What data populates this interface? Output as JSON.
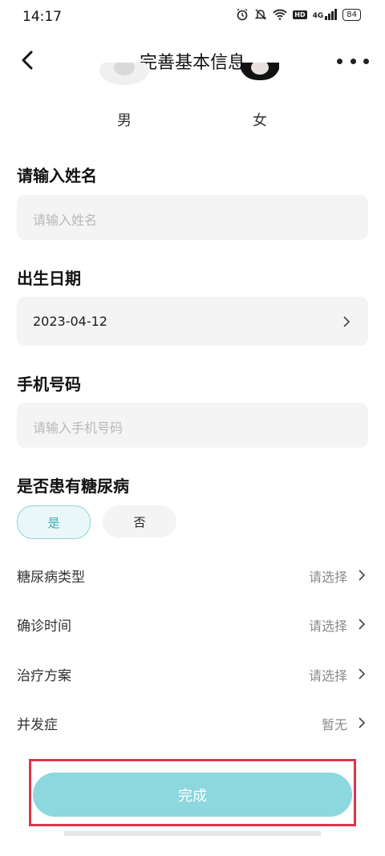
{
  "status": {
    "time": "14:17",
    "battery": "84",
    "network": "4G",
    "hd": "HD"
  },
  "header": {
    "title": "完善基本信息"
  },
  "gender": {
    "male": "男",
    "female": "女"
  },
  "name": {
    "label": "请输入姓名",
    "placeholder": "请输入姓名"
  },
  "birth": {
    "label": "出生日期",
    "value": "2023-04-12"
  },
  "phone": {
    "label": "手机号码",
    "placeholder": "请输入手机号码"
  },
  "diabetes": {
    "label": "是否患有糖尿病",
    "yes": "是",
    "no": "否",
    "selected": "yes"
  },
  "rows": [
    {
      "label": "糖尿病类型",
      "value": "请选择"
    },
    {
      "label": "确诊时间",
      "value": "请选择"
    },
    {
      "label": "治疗方案",
      "value": "请选择"
    },
    {
      "label": "并发症",
      "value": "暂无"
    }
  ],
  "submit": {
    "label": "完成"
  },
  "colors": {
    "accent": "#8dd7de",
    "accent_text": "#3aaeb8",
    "highlight": "#e0344a"
  }
}
